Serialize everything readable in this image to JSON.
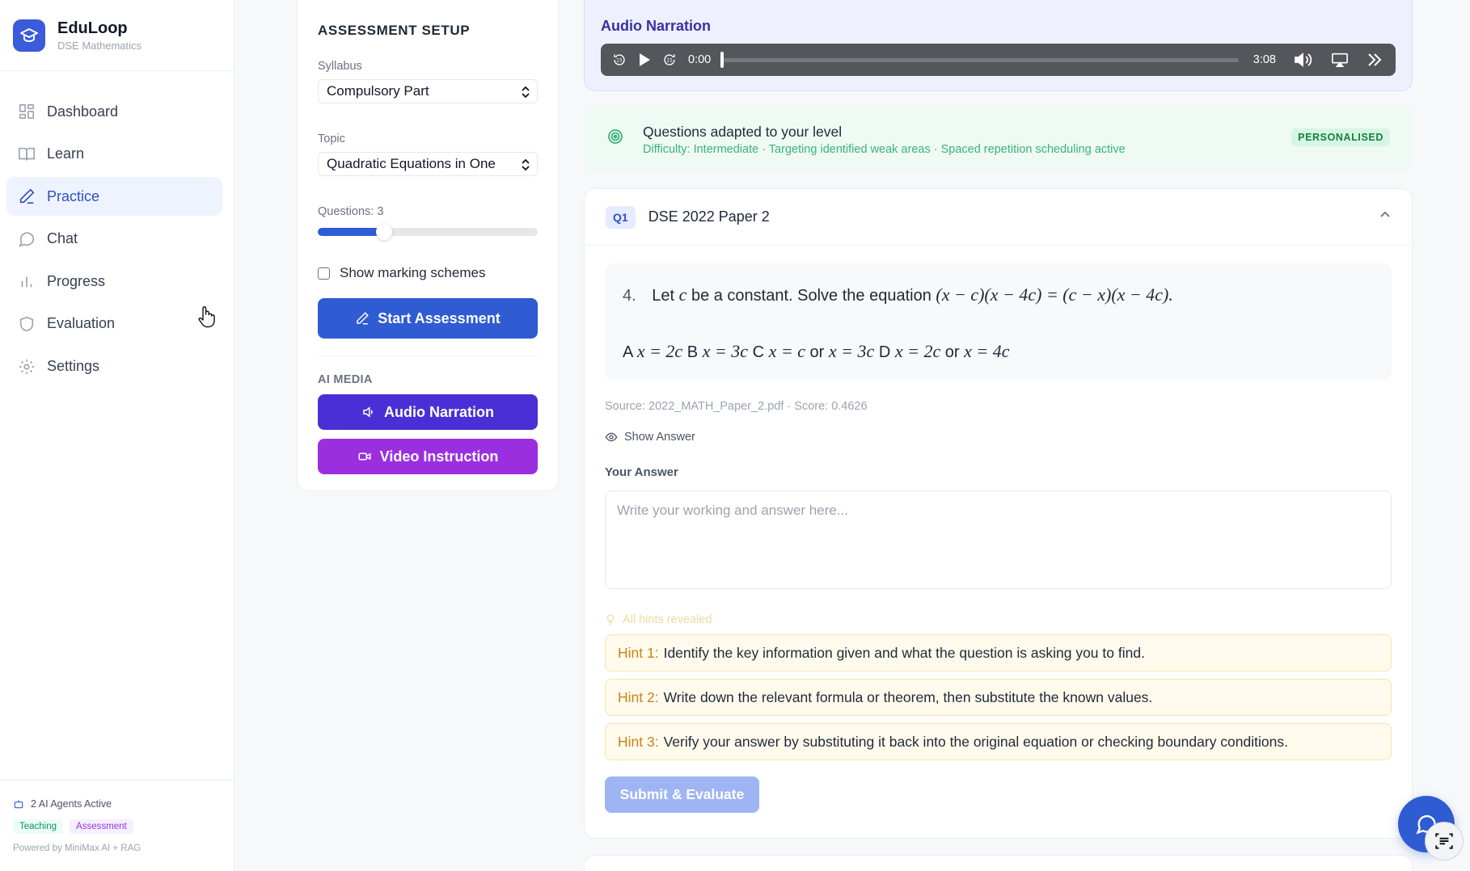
{
  "brand": {
    "name": "EduLoop",
    "subtitle": "DSE Mathematics"
  },
  "sidebar": {
    "items": [
      {
        "label": "Dashboard",
        "icon": "dashboard-icon",
        "active": false
      },
      {
        "label": "Learn",
        "icon": "book-icon",
        "active": false
      },
      {
        "label": "Practice",
        "icon": "pencil-icon",
        "active": true
      },
      {
        "label": "Chat",
        "icon": "chat-bubble-icon",
        "active": false
      },
      {
        "label": "Progress",
        "icon": "bar-chart-icon",
        "active": false
      },
      {
        "label": "Evaluation",
        "icon": "shield-icon",
        "active": false
      },
      {
        "label": "Settings",
        "icon": "gear-icon",
        "active": false
      }
    ],
    "footer": {
      "agents": "2 AI Agents Active",
      "tags": [
        "Teaching",
        "Assessment"
      ],
      "powered": "Powered by MiniMax AI + RAG"
    }
  },
  "setup": {
    "title": "ASSESSMENT SETUP",
    "syllabus_label": "Syllabus",
    "syllabus_value": "Compulsory Part",
    "topic_label": "Topic",
    "topic_value": "Quadratic Equations in One",
    "questions_label": "Questions: 3",
    "questions_slider_fraction": 0.3,
    "marking_label": "Show marking schemes",
    "marking_checked": false,
    "start_label": "Start Assessment",
    "ai_media_label": "AI MEDIA",
    "audio_label": "Audio Narration",
    "video_label": "Video Instruction"
  },
  "audio": {
    "title": "Audio Narration",
    "current_time": "0:00",
    "total_time": "3:08",
    "progress_fraction": 0
  },
  "adapted": {
    "title": "Questions adapted to your level",
    "subtitle": "Difficulty: Intermediate · Targeting identified weak areas · Spaced repetition scheduling active",
    "badge": "PERSONALISED"
  },
  "question": {
    "badge": "Q1",
    "source_title": "DSE 2022 Paper 2",
    "number": "4.",
    "stem_text": "Let",
    "stem_var": "c",
    "stem_text2": "be a constant. Solve the equation",
    "stem_eq": "(x − c)(x − 4c) = (c − x)(x − 4c).",
    "opt_a_label": "A",
    "opt_a": "x = 2c",
    "opt_b_label": "B",
    "opt_b": "x = 3c",
    "opt_c_label": "C",
    "opt_c1": "x = c",
    "opt_or": "or",
    "opt_c2": "x = 3c",
    "opt_d_label": "D",
    "opt_d1": "x = 2c",
    "opt_d2": "x = 4c",
    "meta": "Source: 2022_MATH_Paper_2.pdf · Score: 0.4626",
    "show_answer": "Show Answer",
    "answer_label": "Your Answer",
    "answer_placeholder": "Write your working and answer here...",
    "hints_revealed": "All hints revealed",
    "hints": [
      {
        "key": "Hint 1:",
        "text": "Identify the key information given and what the question is asking you to find."
      },
      {
        "key": "Hint 2:",
        "text": "Write down the relevant formula or theorem, then substitute the known values."
      },
      {
        "key": "Hint 3:",
        "text": "Verify your answer by substituting it back into the original equation or checking boundary conditions."
      }
    ],
    "submit_label": "Submit & Evaluate"
  },
  "colors": {
    "primary": "#2f5bd3",
    "audio_button": "#4b2fd6",
    "video_button": "#9b2fe0",
    "success": "#15803d",
    "hint_key": "#c8841a"
  }
}
